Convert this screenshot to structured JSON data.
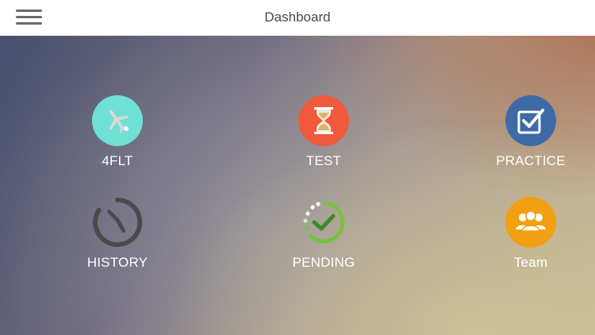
{
  "header": {
    "title": "Dashboard",
    "menu_icon": "hamburger-menu-icon"
  },
  "tiles": [
    {
      "label": "4FLT",
      "icon": "airplane-icon",
      "color": "#6fe0d6"
    },
    {
      "label": "TEST",
      "icon": "hourglass-icon",
      "color": "#ef5a3c"
    },
    {
      "label": "PRACTICE",
      "icon": "checkbox-icon",
      "color": "#3e6aa6"
    },
    {
      "label": "HISTORY",
      "icon": "history-clock-icon",
      "color": "#4a4a4a"
    },
    {
      "label": "PENDING",
      "icon": "pending-check-icon",
      "color": "#7bc043"
    },
    {
      "label": "Team",
      "icon": "team-icon",
      "color": "#f0a010"
    }
  ]
}
